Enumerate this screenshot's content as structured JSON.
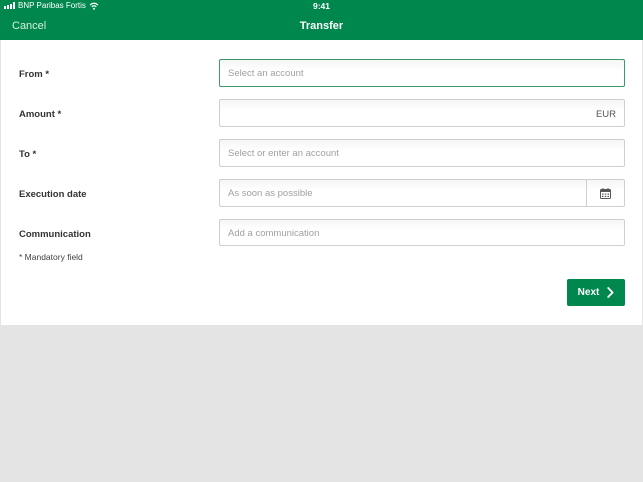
{
  "status_bar": {
    "carrier": "BNP Paribas Fortis",
    "time": "9:41"
  },
  "nav": {
    "cancel_label": "Cancel",
    "title": "Transfer"
  },
  "form": {
    "from": {
      "label": "From *",
      "placeholder": "Select an account"
    },
    "amount": {
      "label": "Amount *",
      "value": "",
      "currency": "EUR"
    },
    "to": {
      "label": "To *",
      "placeholder": "Select or enter an account"
    },
    "execution_date": {
      "label": "Execution date",
      "placeholder": "As soon as possible",
      "icon": "calendar-icon"
    },
    "communication": {
      "label": "Communication",
      "placeholder": "Add a communication"
    },
    "mandatory_note": "* Mandatory field"
  },
  "actions": {
    "next_label": "Next",
    "next_icon": "chevron-right-icon"
  },
  "colors": {
    "brand_green": "#00874e",
    "background": "#e4e4e4"
  }
}
